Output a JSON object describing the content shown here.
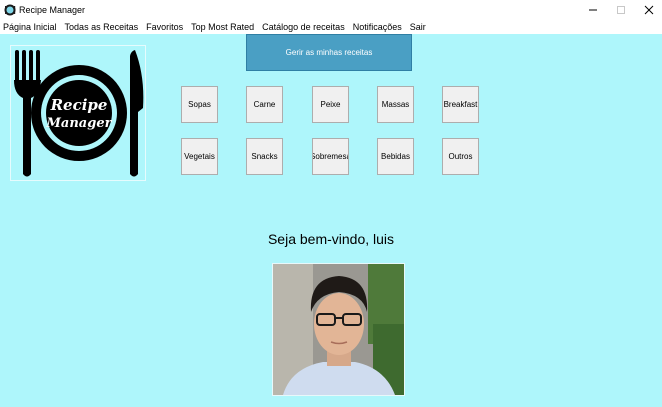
{
  "window": {
    "title": "Recipe Manager"
  },
  "menu": [
    "Página Inicial",
    "Todas as Receitas",
    "Favoritos",
    "Top Most Rated",
    "Catálogo de receitas",
    "Notificações",
    "Sair"
  ],
  "logo": {
    "line1": "Recipe",
    "line2": "Manager"
  },
  "manage_button": "Gerir as minhas receitas",
  "categories": [
    "Sopas",
    "Carne",
    "Peixe",
    "Massas",
    "Breakfast",
    "Vegetais",
    "Snacks",
    "Sobremesa",
    "Bebidas",
    "Outros"
  ],
  "welcome_text": "Seja bem-vindo, luis",
  "colors": {
    "background": "#aef6fb",
    "accent": "#4a9fc4",
    "button": "#f0f0f0"
  }
}
